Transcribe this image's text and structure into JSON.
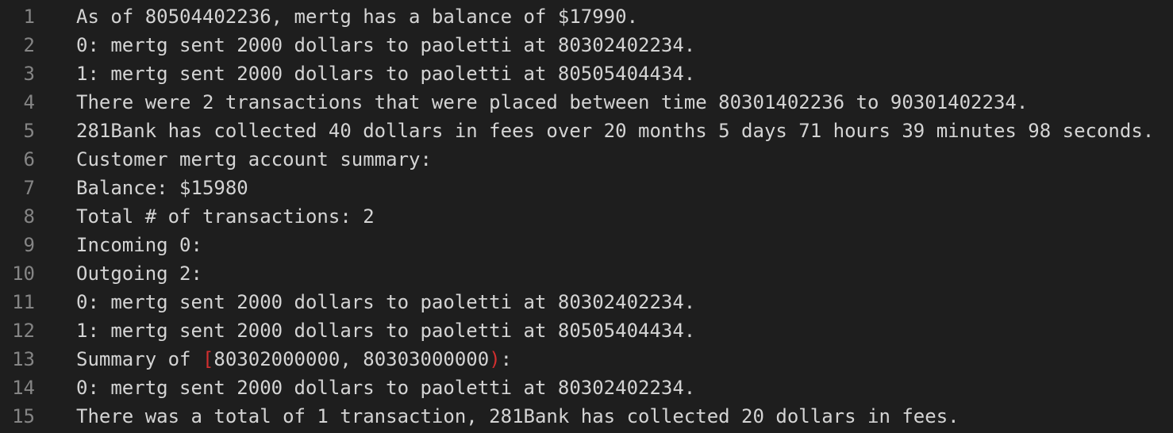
{
  "colors": {
    "background": "#1e1e1e",
    "text": "#d4d4d4",
    "line_number": "#858585",
    "bracket_highlight": "#d32f2f"
  },
  "lines": [
    {
      "number": "1",
      "text": "As of 80504402236, mertg has a balance of $17990."
    },
    {
      "number": "2",
      "text": "0: mertg sent 2000 dollars to paoletti at 80302402234."
    },
    {
      "number": "3",
      "text": "1: mertg sent 2000 dollars to paoletti at 80505404434."
    },
    {
      "number": "4",
      "text": "There were 2 transactions that were placed between time 80301402236 to 90301402234."
    },
    {
      "number": "5",
      "text": "281Bank has collected 40 dollars in fees over 20 months 5 days 71 hours 39 minutes 98 seconds."
    },
    {
      "number": "6",
      "text": "Customer mertg account summary:"
    },
    {
      "number": "7",
      "text": "Balance: $15980"
    },
    {
      "number": "8",
      "text": "Total # of transactions: 2"
    },
    {
      "number": "9",
      "text": "Incoming 0:"
    },
    {
      "number": "10",
      "text": "Outgoing 2:"
    },
    {
      "number": "11",
      "text": "0: mertg sent 2000 dollars to paoletti at 80302402234."
    },
    {
      "number": "12",
      "text": "1: mertg sent 2000 dollars to paoletti at 80505404434."
    },
    {
      "number": "13",
      "text_prefix": "Summary of ",
      "open_bracket": "[",
      "range": "80302000000, 80303000000",
      "close_bracket": ")",
      "text_suffix": ":"
    },
    {
      "number": "14",
      "text": "0: mertg sent 2000 dollars to paoletti at 80302402234."
    },
    {
      "number": "15",
      "text": "There was a total of 1 transaction, 281Bank has collected 20 dollars in fees."
    }
  ]
}
